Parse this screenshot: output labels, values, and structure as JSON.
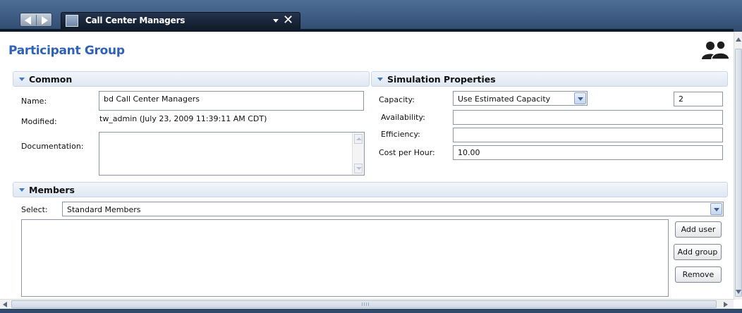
{
  "tab": {
    "title": "Call Center Managers"
  },
  "page": {
    "title": "Participant Group"
  },
  "common": {
    "header": "Common",
    "name_label": "Name:",
    "name_value": "bd Call Center Managers",
    "modified_label": "Modified:",
    "modified_value": "tw_admin (July 23, 2009 11:39:11 AM CDT)",
    "documentation_label": "Documentation:",
    "documentation_value": ""
  },
  "simulation": {
    "header": "Simulation Properties",
    "capacity_label": "Capacity:",
    "capacity_option": "Use Estimated Capacity",
    "capacity_value": "2",
    "availability_label": "Availability:",
    "availability_value": "",
    "efficiency_label": "Efficiency:",
    "efficiency_value": "",
    "cost_label": "Cost per Hour:",
    "cost_value": "10.00"
  },
  "members": {
    "header": "Members",
    "select_label": "Select:",
    "select_value": "Standard Members",
    "add_user": "Add user",
    "add_group": "Add group",
    "remove": "Remove"
  },
  "colors": {
    "title_blue": "#2f62b7",
    "header_bar": "#3d5b82",
    "section_bg": "#e4ebf5"
  },
  "icons": {
    "nav_back": "back-arrow-icon",
    "nav_forward": "forward-arrow-icon",
    "tab_icon": "group-icon",
    "close": "close-icon",
    "page_icon": "people-icon"
  }
}
